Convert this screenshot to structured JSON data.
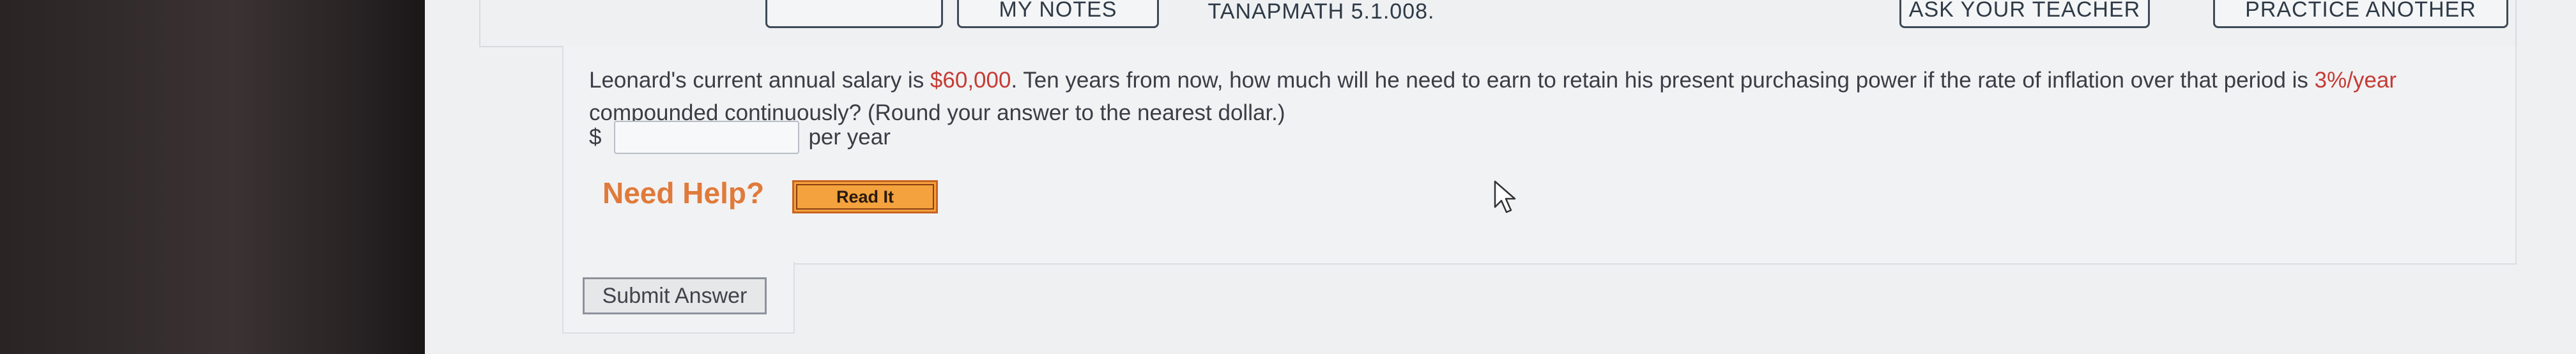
{
  "top_buttons": [
    {
      "label": ""
    },
    {
      "label": "MY NOTES"
    },
    {
      "label": "ASK YOUR TEACHER"
    },
    {
      "label": "PRACTICE ANOTHER"
    }
  ],
  "problem_id": "TANAPMATH 5.1.008.",
  "question": {
    "part1": "Leonard's current annual salary is ",
    "salary": "$60,000",
    "part2": ". Ten years from now, how much will he need to earn to retain his present purchasing power if the rate of inflation over that period is ",
    "rate": "3%/year",
    "part3": " compounded continuously? (Round your answer to the nearest dollar.)"
  },
  "answer": {
    "prefix": "$",
    "value": "",
    "suffix": "per year"
  },
  "help": {
    "label": "Need Help?",
    "read_it": "Read It"
  },
  "submit_label": "Submit Answer",
  "colors": {
    "highlight": "#c53b34",
    "help_text": "#e07a3a",
    "read_it_bg": "#f3a23e"
  }
}
